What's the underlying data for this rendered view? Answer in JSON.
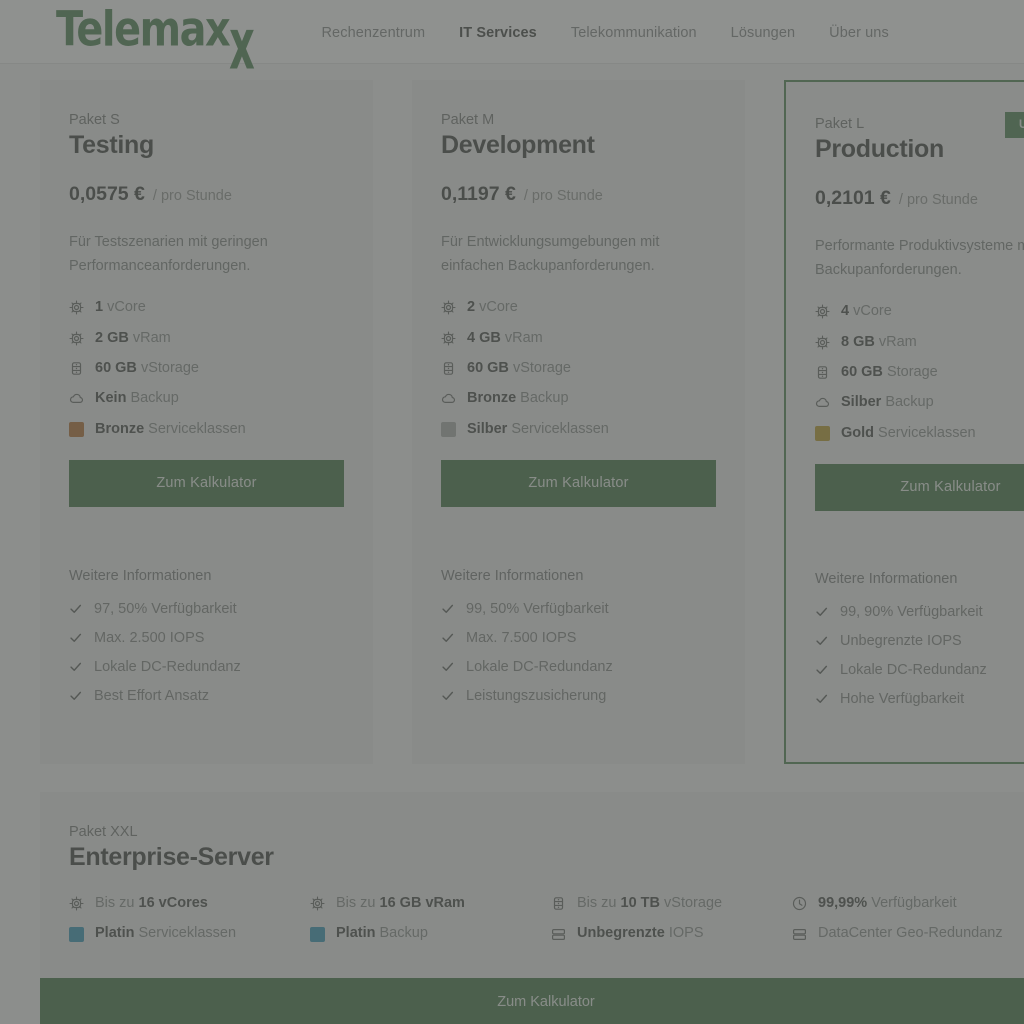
{
  "header": {
    "logo_text": "Telemax",
    "logo_tail": "x",
    "nav": [
      {
        "label": "Rechenzentrum",
        "active": false
      },
      {
        "label": "IT Services",
        "active": true
      },
      {
        "label": "Telekommunikation",
        "active": false
      },
      {
        "label": "Lösungen",
        "active": false
      },
      {
        "label": "Über uns",
        "active": false
      }
    ]
  },
  "colors": {
    "brand_green": "#2d6b33",
    "button_green": "#1f5c24",
    "featured_border": "#2f7035",
    "bronze": "#a8540d",
    "silber": "#9a9d9a",
    "gold": "#b08a05",
    "platin": "#0f83ab",
    "page_bg": "#f3f3f3",
    "card_bg": "#ececec"
  },
  "cards": [
    {
      "package": "Paket S",
      "name": "Testing",
      "price": "0,0575 €",
      "price_unit": "/ pro Stunde",
      "description": "Für Testszenarien mit geringen Performanceanforderungen.",
      "badge": null,
      "featured": false,
      "specs": [
        {
          "icon": "cpu-icon",
          "strong": "1",
          "rest": " vCore"
        },
        {
          "icon": "cpu-icon",
          "strong": "2 GB",
          "rest": " vRam"
        },
        {
          "icon": "database-icon",
          "strong": "60 GB",
          "rest": " vStorage"
        },
        {
          "icon": "cloud-icon",
          "strong": "Kein",
          "rest": " Backup"
        },
        {
          "icon": "swatch-icon",
          "swatch": "#a8540d",
          "strong": "Bronze",
          "rest": " Serviceklassen"
        }
      ],
      "button_label": "Zum Kalkulator",
      "more_title": "Weitere Informationen",
      "more_items": [
        "97, 50% Verfügbarkeit",
        "Max. 2.500 IOPS",
        "Lokale DC-Redundanz",
        "Best Effort Ansatz"
      ]
    },
    {
      "package": "Paket M",
      "name": "Development",
      "price": "0,1197 €",
      "price_unit": "/ pro Stunde",
      "description": "Für Entwicklungsumgebungen mit einfachen Backupanforderungen.",
      "badge": null,
      "featured": false,
      "specs": [
        {
          "icon": "cpu-icon",
          "strong": "2",
          "rest": " vCore"
        },
        {
          "icon": "cpu-icon",
          "strong": "4 GB",
          "rest": " vRam"
        },
        {
          "icon": "database-icon",
          "strong": "60 GB",
          "rest": " vStorage"
        },
        {
          "icon": "cloud-icon",
          "strong": "Bronze",
          "rest": " Backup"
        },
        {
          "icon": "swatch-icon",
          "swatch": "#9a9d9a",
          "strong": "Silber",
          "rest": " Serviceklassen"
        }
      ],
      "button_label": "Zum Kalkulator",
      "more_title": "Weitere Informationen",
      "more_items": [
        "99, 50% Verfügbarkeit",
        "Max. 7.500 IOPS",
        "Lokale DC-Redundanz",
        "Leistungszusicherung"
      ]
    },
    {
      "package": "Paket L",
      "name": "Production",
      "price": "0,2101 €",
      "price_unit": "/ pro Stunde",
      "description": "Performante Produktivsysteme mit hohen Backupanforderungen.",
      "badge": "Unsere Empfehlung",
      "featured": true,
      "specs": [
        {
          "icon": "cpu-icon",
          "strong": "4",
          "rest": " vCore"
        },
        {
          "icon": "cpu-icon",
          "strong": "8 GB",
          "rest": " vRam"
        },
        {
          "icon": "database-icon",
          "strong": "60 GB",
          "rest": " Storage"
        },
        {
          "icon": "cloud-icon",
          "strong": "Silber",
          "rest": " Backup"
        },
        {
          "icon": "swatch-icon",
          "swatch": "#b08a05",
          "strong": "Gold",
          "rest": " Serviceklassen"
        }
      ],
      "button_label": "Zum Kalkulator",
      "more_title": "Weitere Informationen",
      "more_items": [
        "99, 90% Verfügbarkeit",
        "Unbegrenzte IOPS",
        "Lokale DC-Redundanz",
        "Hohe Verfügbarkeit"
      ]
    }
  ],
  "xxl": {
    "package": "Paket XXL",
    "name": "Enterprise-Server",
    "button_label": "Zum Kalkulator",
    "specs": [
      {
        "icon": "cpu-icon",
        "pre": "Bis zu ",
        "strong": "16 vCores",
        "rest": ""
      },
      {
        "icon": "cpu-icon",
        "pre": "Bis zu ",
        "strong": "16 GB vRam",
        "rest": ""
      },
      {
        "icon": "database-icon",
        "pre": "Bis zu ",
        "strong": "10 TB",
        "rest": " vStorage"
      },
      {
        "icon": "clock-icon",
        "pre": "",
        "strong": "99,99%",
        "rest": " Verfügbarkeit"
      },
      {
        "icon": "swatch-icon",
        "swatch": "#0f83ab",
        "pre": "",
        "strong": "Platin",
        "rest": " Serviceklassen"
      },
      {
        "icon": "swatch-icon",
        "swatch": "#0f83ab",
        "pre": "",
        "strong": "Platin",
        "rest": " Backup"
      },
      {
        "icon": "server-icon",
        "pre": "",
        "strong": "Unbegrenzte",
        "rest": " IOPS"
      },
      {
        "icon": "server-icon",
        "pre": "",
        "strong": "",
        "rest": "DataCenter Geo-Redundanz"
      }
    ]
  }
}
